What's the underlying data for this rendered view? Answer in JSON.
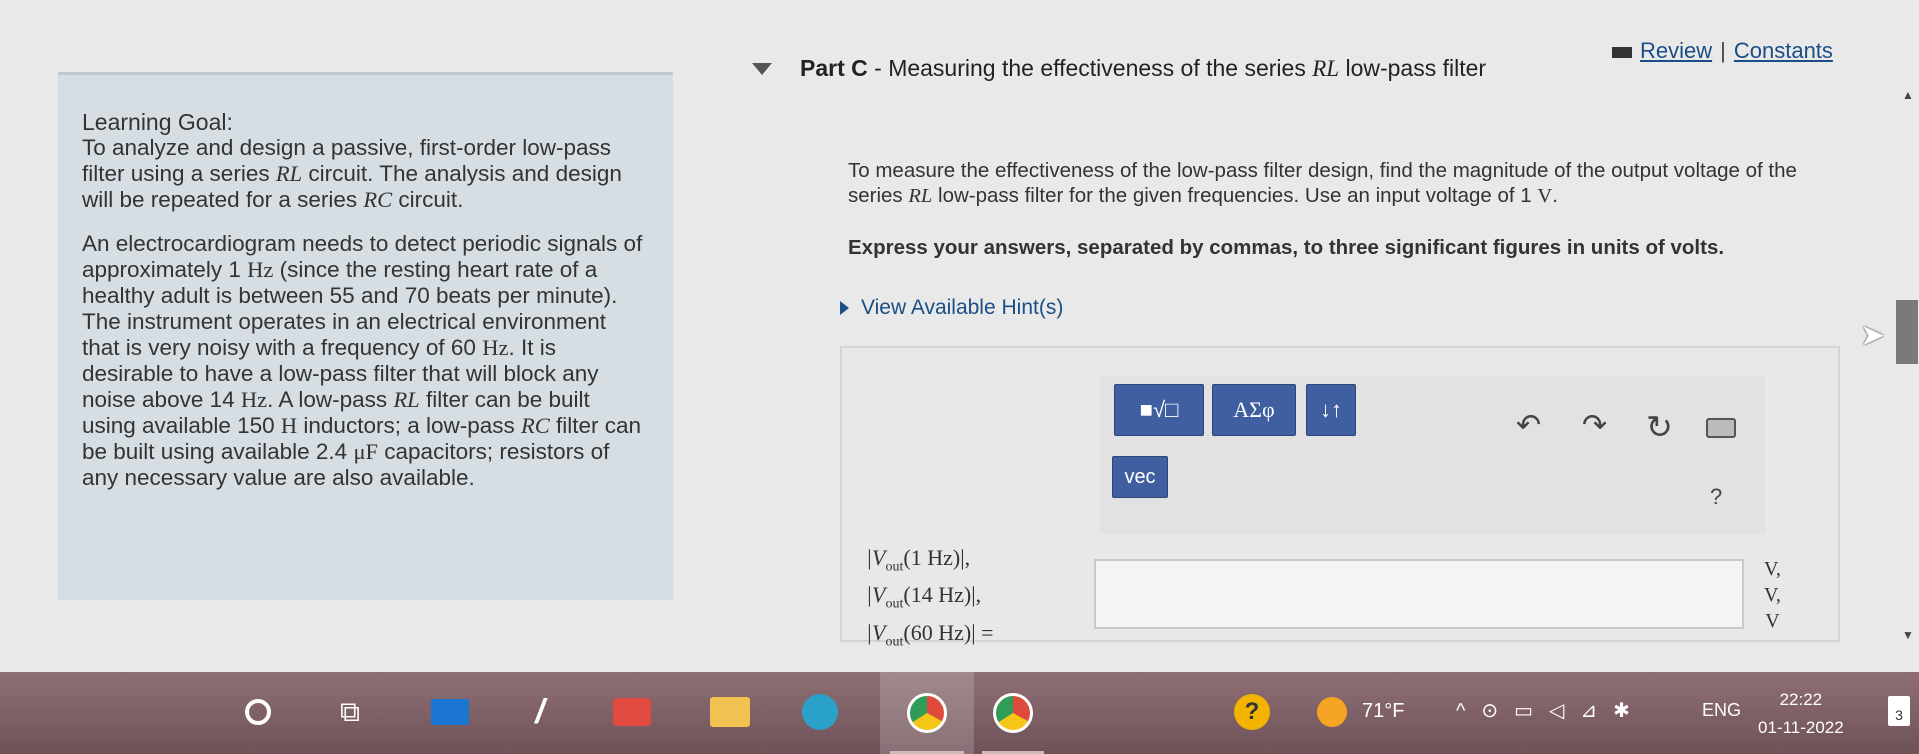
{
  "header": {
    "review_label": "Review",
    "separator": "|",
    "constants_label": "Constants"
  },
  "goal": {
    "heading": "Learning Goal:",
    "intro_a": "To analyze and design a passive, first-order low-pass filter using a series ",
    "intro_rl": "RL",
    "intro_b": " circuit. The analysis and design will be repeated for a series ",
    "intro_rc": "RC",
    "intro_c": " circuit.",
    "p2_a": "An electrocardiogram needs to detect periodic signals of approximately 1 ",
    "p2_hz1": "Hz",
    "p2_b": " (since the resting heart rate of a healthy adult is between 55 and 70 beats per minute). The instrument operates in an electrical environment that is very noisy with a frequency of 60 ",
    "p2_hz2": "Hz",
    "p2_c": ". It is desirable to have a low-pass filter that will block any noise above 14 ",
    "p2_hz3": "Hz",
    "p2_d": ". A low-pass ",
    "p2_rl": "RL",
    "p2_e": " filter can be built using available 150 ",
    "p2_h": "H",
    "p2_f": " inductors; a low-pass ",
    "p2_rc": "RC",
    "p2_g": " filter can be built using available 2.4 ",
    "p2_uf": "μF",
    "p2_end": " capacitors; resistors of any necessary value are also available."
  },
  "part": {
    "title_a": "Part C",
    "title_b": " - Measuring the effectiveness of the series ",
    "title_rl": "RL",
    "title_c": " low-pass filter"
  },
  "question": {
    "text_a": "To measure the effectiveness of the low-pass filter design, find the magnitude of the output voltage of the series ",
    "text_rl": "RL",
    "text_b": " low-pass filter for the given frequencies. Use an input voltage of 1 ",
    "text_v": "V",
    "text_c": ".",
    "instruction": "Express your answers, separated by commas, to three significant figures in units of volts.",
    "hint": "View Available Hint(s)"
  },
  "toolbar": {
    "templates_label": "■√□",
    "greek_label": "ΑΣφ",
    "arrows_label": "↓↑",
    "vec_label": "vec",
    "help_label": "?"
  },
  "answer": {
    "label1": "|V",
    "sub": "out",
    "f1": "(1 Hz)|,",
    "f2": "(14 Hz)|,",
    "f3": "(60 Hz)| =",
    "value": "",
    "unit1": "V,",
    "unit2": "V,",
    "unit3": "V"
  },
  "taskbar": {
    "temperature": "71°F",
    "language": "ENG",
    "time": "22:22",
    "date": "01-11-2022",
    "notifications": "3"
  }
}
